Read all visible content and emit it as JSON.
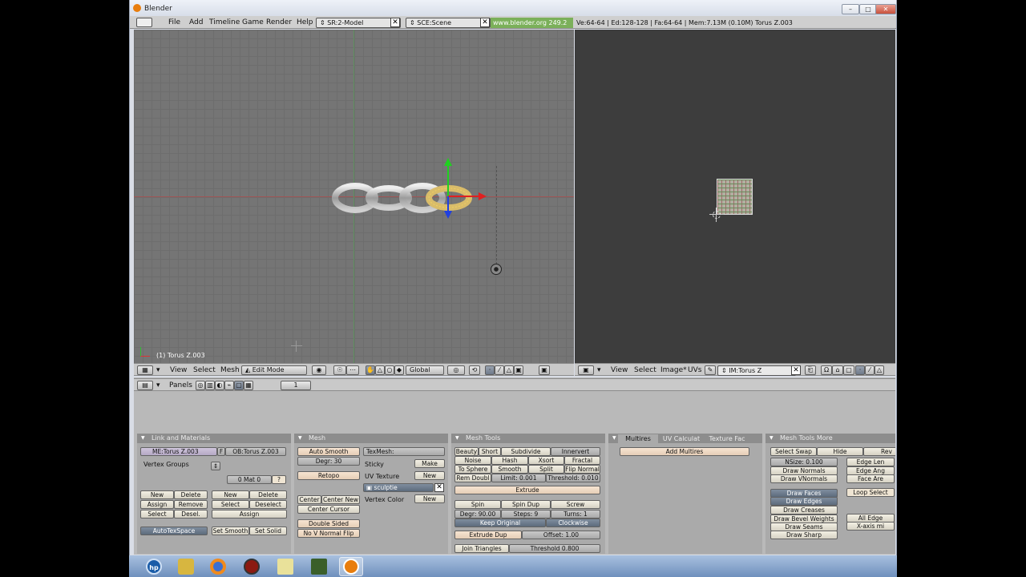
{
  "window": {
    "title": "Blender"
  },
  "menu": {
    "items": [
      "File",
      "Add",
      "Timeline",
      "Game",
      "Render",
      "Help"
    ],
    "screen": "SR:2-Model",
    "scene": "SCE:Scene",
    "link": "www.blender.org 249.2",
    "stats": "Ve:64-64 | Ed:128-128 | Fa:64-64 | Mem:7.13M (0.10M) Torus Z.003"
  },
  "viewport3d": {
    "object_label": "(1) Torus Z.003"
  },
  "header3d": {
    "view": "View",
    "select": "Select",
    "mesh": "Mesh",
    "mode": "Edit Mode",
    "orientation": "Global"
  },
  "headeruv": {
    "view": "View",
    "select": "Select",
    "image": "Image*",
    "uvs": "UVs",
    "image_name": "IM:Torus Z"
  },
  "buttons_header": {
    "panels": "Panels",
    "frame": "1"
  },
  "panel_link": {
    "title": "Link and Materials",
    "me": "ME:Torus Z.003",
    "f": "F",
    "ob": "OB:Torus Z.003",
    "vertex_groups": "Vertex Groups",
    "mat": "0 Mat 0",
    "q": "?",
    "new1": "New",
    "delete1": "Delete",
    "new2": "New",
    "delete2": "Delete",
    "assign1": "Assign",
    "remove": "Remove",
    "select2": "Select",
    "deselect": "Deselect",
    "select1": "Select",
    "desel": "Desel.",
    "assign2": "Assign",
    "autotexspace": "AutoTexSpace",
    "set_smooth": "Set Smooth",
    "set_solid": "Set Solid"
  },
  "panel_mesh": {
    "title": "Mesh",
    "auto_smooth": "Auto Smooth",
    "degr": "Degr: 30",
    "retopo": "Retopo",
    "center": "Center",
    "center_new": "Center New",
    "center_cursor": "Center Cursor",
    "double_sided": "Double Sided",
    "no_v_normal_flip": "No V Normal Flip",
    "texmesh": "TexMesh:",
    "sticky": "Sticky",
    "make": "Make",
    "uv_texture": "UV Texture",
    "new_uv": "New",
    "sculptie": "sculptie",
    "vertex_color": "Vertex Color",
    "new_vc": "New"
  },
  "panel_tools": {
    "title": "Mesh Tools",
    "beauty": "Beauty",
    "short": "Short",
    "subdivide": "Subdivide",
    "innervert": "Innervert",
    "noise": "Noise",
    "hash": "Hash",
    "xsort": "Xsort",
    "fractal": "Fractal",
    "to_sphere": "To Sphere",
    "smooth": "Smooth",
    "split": "Split",
    "flip_normal": "Flip Normal",
    "rem_doubl": "Rem Doubl",
    "limit": "Limit: 0.001",
    "threshold": "Threshold: 0.010",
    "extrude": "Extrude",
    "spin": "Spin",
    "spin_dup": "Spin Dup",
    "screw": "Screw",
    "degr": "Degr: 90.00",
    "steps": "Steps: 9",
    "turns": "Turns: 1",
    "keep_original": "Keep Original",
    "clockwise": "Clockwise",
    "extrude_dup": "Extrude Dup",
    "offset": "Offset: 1.00",
    "join_triangles": "Join Triangles",
    "threshold2": "Threshold 0.800"
  },
  "panel_multires": {
    "tab1": "Multires",
    "tab2": "UV Calculat",
    "tab3": "Texture Fac",
    "add_multires": "Add Multires"
  },
  "panel_more": {
    "title": "Mesh Tools More",
    "select_swap": "Select Swap",
    "hide": "Hide",
    "rev": "Rev",
    "nsize": "NSize: 0.100",
    "edge_len": "Edge Len",
    "draw_normals": "Draw Normals",
    "edge_ang": "Edge Ang",
    "draw_vnormals": "Draw VNormals",
    "face_are": "Face Are",
    "draw_faces": "Draw Faces",
    "loop_select": "Loop Select",
    "draw_edges": "Draw Edges",
    "draw_creases": "Draw Creases",
    "draw_bevel": "Draw Bevel Weights",
    "all_edge": "All Edge",
    "draw_seams": "Draw Seams",
    "x_axis": "X-axis mi",
    "draw_sharp": "Draw Sharp"
  },
  "taskbar": {
    "start_label": "hp"
  }
}
